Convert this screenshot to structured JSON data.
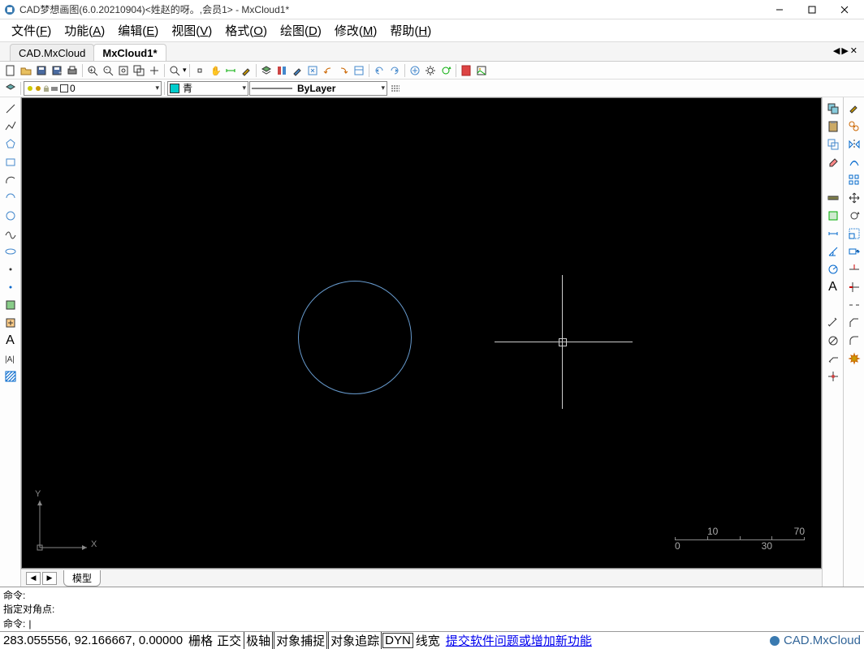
{
  "title": "CAD梦想画图(6.0.20210904)<姓赵的呀。,会员1> - MxCloud1*",
  "menu": [
    {
      "label": "文件",
      "accel": "F"
    },
    {
      "label": "功能",
      "accel": "A"
    },
    {
      "label": "编辑",
      "accel": "E"
    },
    {
      "label": "视图",
      "accel": "V"
    },
    {
      "label": "格式",
      "accel": "O"
    },
    {
      "label": "绘图",
      "accel": "D"
    },
    {
      "label": "修改",
      "accel": "M"
    },
    {
      "label": "帮助",
      "accel": "H"
    }
  ],
  "doc_tabs": [
    {
      "label": "CAD.MxCloud",
      "active": false
    },
    {
      "label": "MxCloud1*",
      "active": true
    }
  ],
  "layer_combo": "0",
  "color_combo": "青",
  "linetype_combo": "ByLayer",
  "model_tab": "模型",
  "cmd": {
    "line1": "命令:",
    "line2": "指定对角点:",
    "prompt": "命令:",
    "input": "|"
  },
  "status": {
    "coords": "283.055556, 92.166667, 0.00000",
    "grid": "栅格",
    "ortho": "正交",
    "polar": "极轴",
    "osnap": "对象捕捉",
    "otrack": "对象追踪",
    "dyn": "DYN",
    "lweight": "线宽",
    "link": "提交软件问题或增加新功能",
    "brand": "CAD.MxCloud"
  },
  "scale": {
    "t1": "10",
    "t2": "70",
    "b1": "0",
    "b2": "30"
  },
  "ucs": {
    "x": "X",
    "y": "Y"
  }
}
